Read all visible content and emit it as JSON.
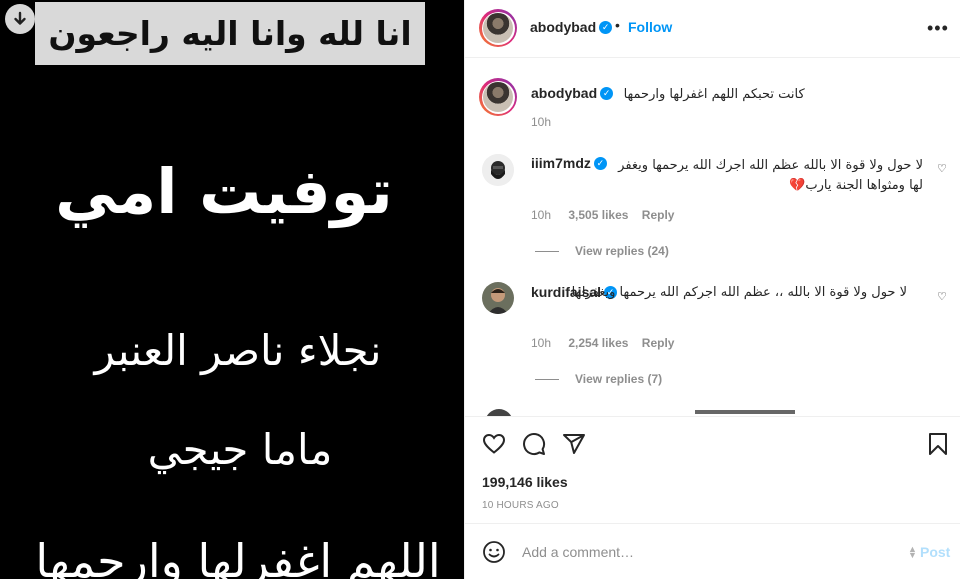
{
  "image": {
    "banner": "انا لله وانا اليه راجعون",
    "line1": "توفيت امي",
    "line2": "نجلاء ناصر العنبر",
    "line3": "ماما جيجي",
    "line4": "اللهم اغفرلها وارحمها"
  },
  "header": {
    "username": "abodybad",
    "separator": "•",
    "follow_label": "Follow",
    "more_label": "•••"
  },
  "caption": {
    "username": "abodybad",
    "text": "كانت تحبكم اللهم اغفرلها وارحمها",
    "time": "10h"
  },
  "comments": [
    {
      "username": "iiim7mdz",
      "text": "لا حول ولا قوة الا بالله عظم الله اجرك الله يرحمها ويغفر لها ومثواها الجنة يارب💔",
      "time": "10h",
      "likes": "3,505 likes",
      "reply": "Reply",
      "view_replies": "View replies (24)"
    },
    {
      "username": "kurdifaisal",
      "text": "لا حول ولا قوة الا بالله ،، عظم الله اجركم الله يرحمها ويغفرلها",
      "time": "10h",
      "likes": "2,254 likes",
      "reply": "Reply",
      "view_replies": "View replies (7)"
    }
  ],
  "actions": {
    "likes": "199,146 likes",
    "time_ago": "10 HOURS AGO"
  },
  "comment_box": {
    "placeholder": "Add a comment…",
    "post_label": "Post"
  },
  "colors": {
    "accent": "#0095f6",
    "muted": "#8e8e8e",
    "heart_red": "#c8102e"
  }
}
